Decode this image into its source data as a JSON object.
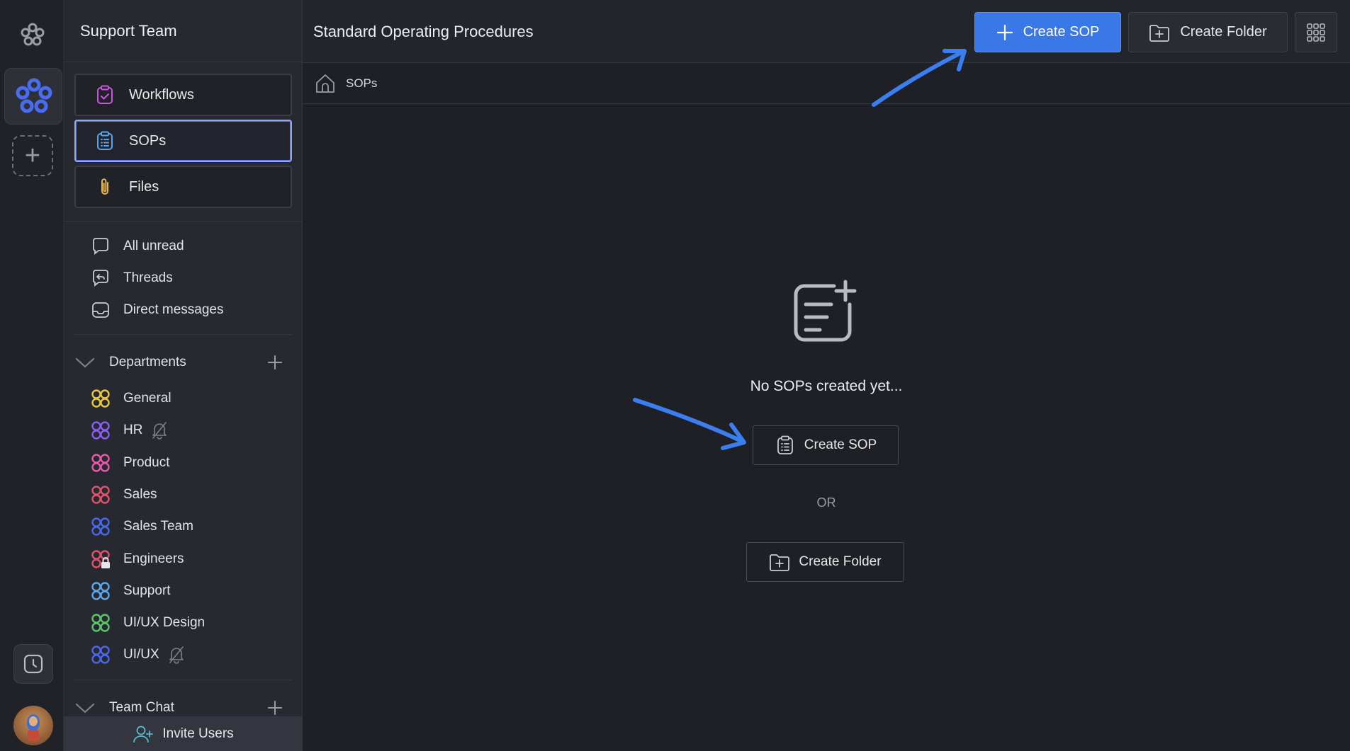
{
  "team": {
    "name": "Support Team"
  },
  "nav": {
    "workflows": "Workflows",
    "sops": "SOPs",
    "files": "Files"
  },
  "quick": {
    "all_unread": "All unread",
    "threads": "Threads",
    "direct_messages": "Direct messages"
  },
  "departments": {
    "label": "Departments",
    "items": [
      {
        "label": "General",
        "color": "#e8c542",
        "muted": false
      },
      {
        "label": "HR",
        "color": "#8a5cf0",
        "muted": true
      },
      {
        "label": "Product",
        "color": "#e25aa8",
        "muted": false
      },
      {
        "label": "Sales",
        "color": "#e2516a",
        "muted": false
      },
      {
        "label": "Sales Team",
        "color": "#4a67e8",
        "muted": false
      },
      {
        "label": "Engineers",
        "color": "#e2516a",
        "muted": false,
        "locked": true
      },
      {
        "label": "Support",
        "color": "#5aa6ea",
        "muted": false
      },
      {
        "label": "UI/UX Design",
        "color": "#5cc46a",
        "muted": false
      },
      {
        "label": "UI/UX",
        "color": "#4a67e8",
        "muted": true
      }
    ]
  },
  "team_chat": {
    "label": "Team Chat"
  },
  "invite": {
    "label": "Invite Users"
  },
  "header": {
    "title": "Standard Operating Procedures",
    "create_sop": "Create SOP",
    "create_folder": "Create Folder"
  },
  "breadcrumb": {
    "current": "SOPs"
  },
  "empty_state": {
    "message": "No SOPs created yet...",
    "create_sop": "Create SOP",
    "or": "OR",
    "create_folder": "Create Folder"
  },
  "colors": {
    "accent": "#3b78e7",
    "arrow": "#3b7ef0",
    "active_border": "#8fa6ff"
  }
}
